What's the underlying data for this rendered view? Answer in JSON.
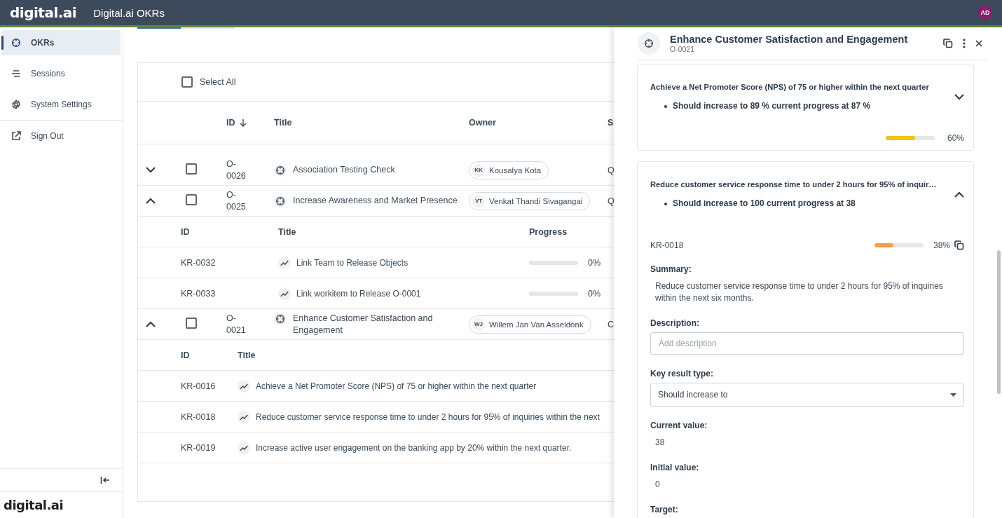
{
  "header": {
    "logo": "digital.ai",
    "app_title": "Digital.ai OKRs",
    "avatar": "AD"
  },
  "sidebar": {
    "items": [
      {
        "label": "OKRs",
        "selected": true
      },
      {
        "label": "Sessions",
        "selected": false
      },
      {
        "label": "System Settings",
        "selected": false
      }
    ],
    "footer_items": [
      {
        "label": "Sign Out"
      }
    ],
    "bottom_logo": "digital.ai"
  },
  "tab_strip": [
    {
      "selected": true
    },
    {
      "selected": false
    }
  ],
  "table": {
    "select_all": {
      "label": "Select All",
      "checked": false
    },
    "columns": [
      {
        "label": "ID",
        "sort_descending": true
      },
      {
        "label": "Title"
      },
      {
        "label": "Owner"
      },
      {
        "label": "S"
      }
    ],
    "rows": [
      {
        "expanded": false,
        "checked": false,
        "id": "O-0026",
        "title": "Association Testing Check",
        "owner_initials": "KK",
        "owner": "Kousalya Kota",
        "column_4": "Q"
      },
      {
        "expanded": true,
        "checked": false,
        "id": "O-0025",
        "title": "Increase Awareness and Market Presence",
        "owner_initials": "VT",
        "owner": "Venkat Thandi Sivagangai",
        "column_4": "Q",
        "sub_columns": [
          "ID",
          "Title",
          "Progress"
        ],
        "key_results": [
          {
            "id": "KR-0032",
            "title": "Link Team to Release Objects",
            "level": 0,
            "percent": "0%"
          },
          {
            "id": "KR-0033",
            "title": "Link workitem to Release O-0001",
            "level": 0,
            "percent": "0%"
          }
        ]
      },
      {
        "expanded": true,
        "checked": false,
        "id": "O-0021",
        "title": "Enhance Customer Satisfaction and Engagement",
        "owner_initials": "WJ",
        "owner": "Willem Jan Van Asseldonk",
        "column_4": "C",
        "sub_columns": [
          "ID",
          "Title"
        ],
        "key_results": [
          {
            "id": "KR-0016",
            "title": "Achieve a Net Promoter Score (NPS) of 75 or higher within the next quarter"
          },
          {
            "id": "KR-0018",
            "title": "Reduce customer service response time to under 2 hours for 95% of inquiries within the next"
          },
          {
            "id": "KR-0019",
            "title": "Increase active user engagement on the banking app by 20% within the next quarter."
          }
        ]
      }
    ]
  },
  "drawer": {
    "title": "Enhance Customer Satisfaction and Engagement",
    "subtitle": "O-0021",
    "key_results": [
      {
        "title": "Achieve a Net Promoter Score (NPS) of 75 or higher within the next quarter",
        "detail": "Should increase to 89 % current progress at 87 %",
        "expanded": false,
        "level": 0.6,
        "percent": "60%",
        "color": "#f2c314"
      },
      {
        "title": "Reduce customer service response time to under 2 hours for 95% of inquir…",
        "detail": "Should increase to 100 current progress at 38",
        "expanded": true,
        "id": "KR-0018",
        "level": 0.38,
        "percent": "38%",
        "color": "#f89c47",
        "fields": [
          {
            "kind": "text",
            "label": "Summary:",
            "value": "Reduce customer service response time to under 2 hours for 95% of inquiries within the next six months."
          },
          {
            "kind": "input",
            "label": "Description:",
            "placeholder": "Add description"
          },
          {
            "kind": "select",
            "label": "Key result type:",
            "value": "Should increase to"
          },
          {
            "kind": "text",
            "label": "Current value:",
            "value": "38"
          },
          {
            "kind": "text",
            "label": "Initial value:",
            "value": "0"
          },
          {
            "kind": "label",
            "label": "Target:"
          }
        ]
      }
    ]
  }
}
